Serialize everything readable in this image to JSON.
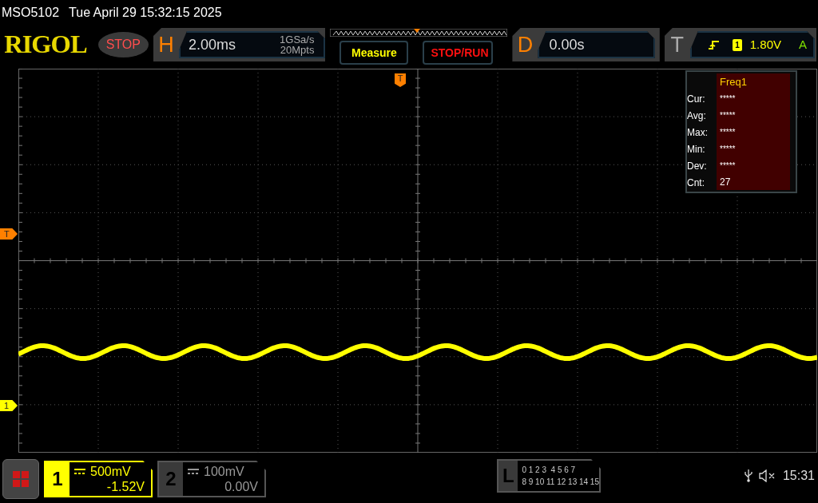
{
  "status_line": {
    "model": "MSO5102",
    "datetime": "Tue April 29 15:32:15 2025"
  },
  "header": {
    "logo": "RIGOL",
    "run_state": "STOP",
    "horizontal": {
      "label": "H",
      "timebase": "2.00ms",
      "sample_rate": "1GSa/s",
      "memory_depth": "20Mpts"
    },
    "buttons": [
      {
        "label": "Measure",
        "kind": "measure"
      },
      {
        "label": "STOP/RUN",
        "kind": "stoprun"
      }
    ],
    "delay": {
      "label": "D",
      "value": "0.00s"
    },
    "trigger": {
      "label": "T",
      "source": "1",
      "level": "1.80V",
      "mode": "A"
    }
  },
  "plot": {
    "trigger_position_marker": "T",
    "trigger_level_marker": "T",
    "channel_marker": "1",
    "measurement": {
      "title": "Freq1",
      "rows": [
        {
          "label": "Cur:",
          "value": "*****"
        },
        {
          "label": "Avg:",
          "value": "*****"
        },
        {
          "label": "Max:",
          "value": "*****"
        },
        {
          "label": "Min:",
          "value": "*****"
        },
        {
          "label": "Dev:",
          "value": "*****"
        },
        {
          "label": "Cnt:",
          "value": "27"
        }
      ]
    }
  },
  "footer": {
    "channels": [
      {
        "number": "1",
        "scale": "500mV",
        "offset": "-1.52V",
        "selected": true
      },
      {
        "number": "2",
        "scale": "100mV",
        "offset": "0.00V",
        "selected": false
      }
    ],
    "logic": {
      "label": "L",
      "row1": "0 1 2 3  4 5 6 7",
      "row2": "8 9 10 11 12 13 14 15"
    },
    "time": "15:31"
  }
}
